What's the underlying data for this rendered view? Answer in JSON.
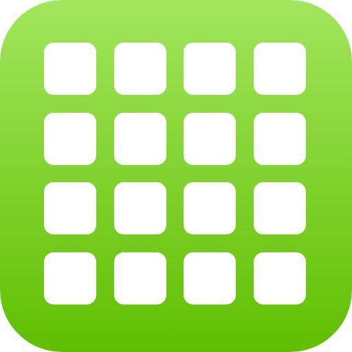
{
  "app_icon": {
    "name": "grid-app-icon",
    "gradient_top": "#a3e65e",
    "gradient_bottom": "#5fbf00",
    "tile_color": "#ffffff",
    "rows": 4,
    "columns": 4
  }
}
